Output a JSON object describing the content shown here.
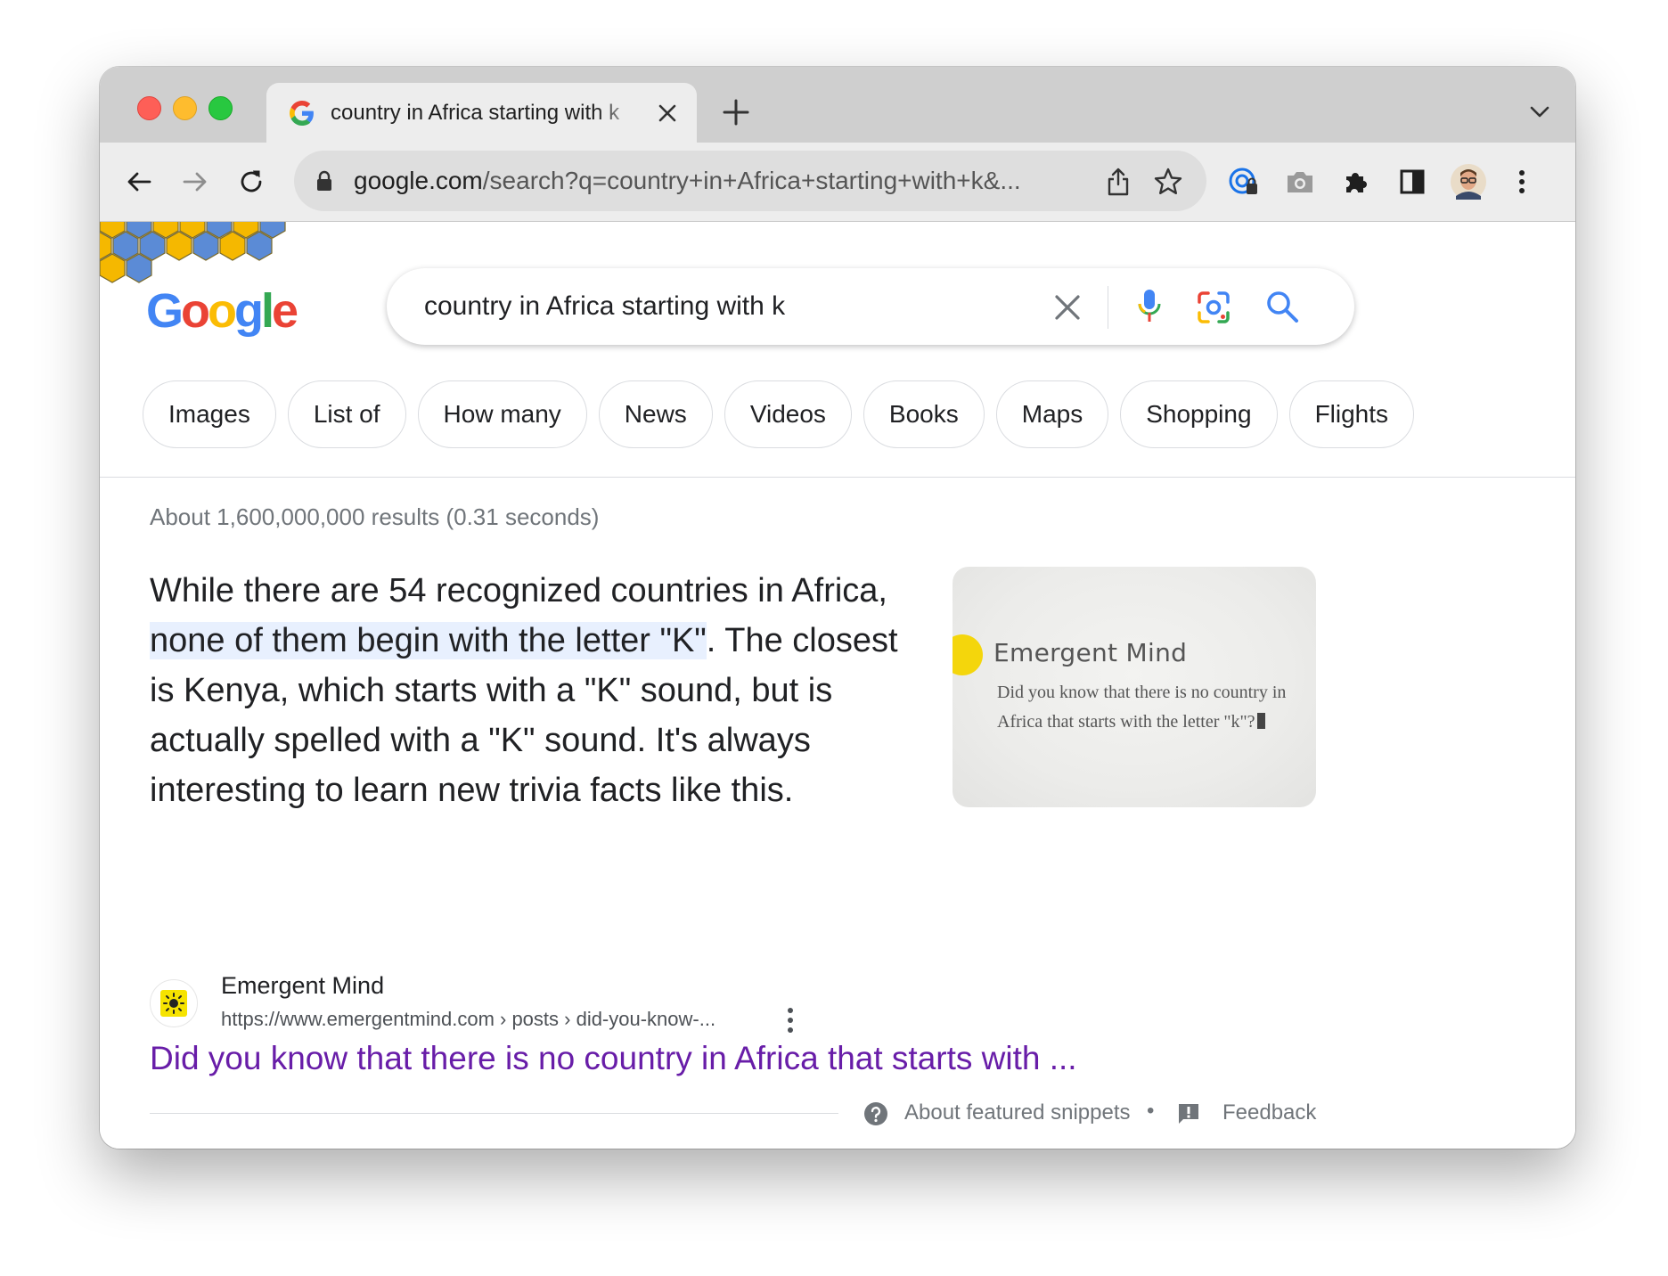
{
  "browser": {
    "tab": {
      "title": "country in Africa starting with k",
      "favicon": "google-g-icon"
    },
    "url": {
      "host": "google.com",
      "path": "/search?q=country+in+Africa+starting+with+k&..."
    },
    "toolbar_icons": [
      "back-icon",
      "forward-icon",
      "reload-icon",
      "share-icon",
      "star-icon",
      "password-manager-icon",
      "camera-icon",
      "extensions-icon",
      "side-panel-icon",
      "profile-avatar",
      "menu-dots-icon"
    ]
  },
  "search": {
    "query": "country in Africa starting with k",
    "icons": [
      "clear-icon",
      "mic-icon",
      "lens-icon",
      "search-icon"
    ]
  },
  "chips": [
    "Images",
    "List of",
    "How many",
    "News",
    "Videos",
    "Books",
    "Maps",
    "Shopping",
    "Flights"
  ],
  "results_stats": "About 1,600,000,000 results (0.31 seconds)",
  "snippet": {
    "before": "While there are 54 recognized countries in Africa, ",
    "highlight": "none of them begin with the letter \"K\"",
    "after": ". The closest is Kenya, which starts with a \"K\" sound, but is actually spelled with a \"K\" sound. It's always interesting to learn new trivia facts like this.",
    "thumbnail": {
      "title": "Emergent Mind",
      "line1": "Did you know that there is no country in",
      "line2": "Africa that starts with the letter \"k\"?"
    }
  },
  "source": {
    "name": "Emergent Mind",
    "url": "https://www.emergentmind.com › posts › did-you-know-...",
    "result_title": "Did you know that there is no country in Africa that starts with ..."
  },
  "footer": {
    "about": "About featured snippets",
    "separator": "•",
    "feedback": "Feedback"
  },
  "colors": {
    "link_visited": "#681da8",
    "highlight": "#e8f0fe",
    "google_blue": "#4285f4",
    "google_red": "#ea4335",
    "google_yellow": "#fbbc04",
    "google_green": "#34a853"
  }
}
